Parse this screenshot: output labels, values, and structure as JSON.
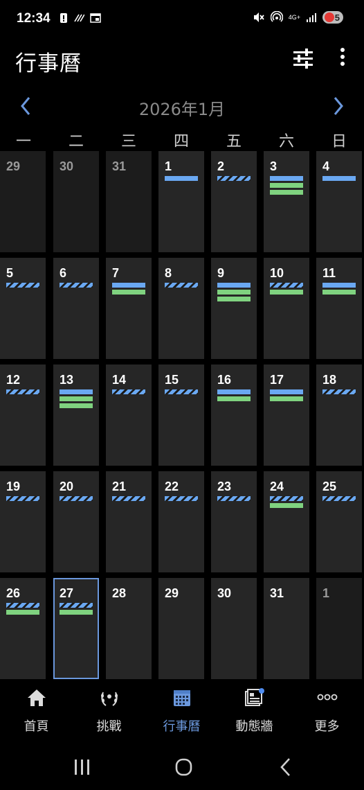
{
  "status_bar": {
    "time": "12:34",
    "network_label": "4G+",
    "battery_level": "5",
    "icons": [
      "alert-icon",
      "stripes-icon",
      "calendar-small-icon",
      "mute-icon",
      "hotspot-icon",
      "signal-icon",
      "battery-icon"
    ]
  },
  "app_bar": {
    "title": "行事曆",
    "icons": [
      "filter-sliders-icon",
      "more-vert-icon"
    ]
  },
  "month_header": {
    "label": "2026年1月",
    "prev_icon": "chevron-left-icon",
    "next_icon": "chevron-right-icon"
  },
  "weekdays": [
    "一",
    "二",
    "三",
    "四",
    "五",
    "六",
    "日"
  ],
  "weeks": [
    [
      {
        "day": "29",
        "dim": true,
        "bars": []
      },
      {
        "day": "30",
        "dim": true,
        "bars": []
      },
      {
        "day": "31",
        "dim": true,
        "bars": []
      },
      {
        "day": "1",
        "bars": [
          "solid"
        ]
      },
      {
        "day": "2",
        "bars": [
          "striped"
        ]
      },
      {
        "day": "3",
        "bars": [
          "solid",
          "green",
          "green"
        ]
      },
      {
        "day": "4",
        "bars": [
          "solid"
        ]
      }
    ],
    [
      {
        "day": "5",
        "bars": [
          "striped"
        ]
      },
      {
        "day": "6",
        "bars": [
          "striped"
        ]
      },
      {
        "day": "7",
        "bars": [
          "solid",
          "green"
        ]
      },
      {
        "day": "8",
        "bars": [
          "striped"
        ]
      },
      {
        "day": "9",
        "bars": [
          "solid",
          "green",
          "green"
        ]
      },
      {
        "day": "10",
        "bars": [
          "striped",
          "green"
        ]
      },
      {
        "day": "11",
        "bars": [
          "solid",
          "green"
        ]
      }
    ],
    [
      {
        "day": "12",
        "bars": [
          "striped"
        ]
      },
      {
        "day": "13",
        "bars": [
          "solid",
          "green",
          "green"
        ]
      },
      {
        "day": "14",
        "bars": [
          "striped"
        ]
      },
      {
        "day": "15",
        "bars": [
          "striped"
        ]
      },
      {
        "day": "16",
        "bars": [
          "solid",
          "green"
        ]
      },
      {
        "day": "17",
        "bars": [
          "solid",
          "green"
        ]
      },
      {
        "day": "18",
        "bars": [
          "striped"
        ]
      }
    ],
    [
      {
        "day": "19",
        "bars": [
          "striped"
        ]
      },
      {
        "day": "20",
        "bars": [
          "striped"
        ]
      },
      {
        "day": "21",
        "bars": [
          "striped"
        ]
      },
      {
        "day": "22",
        "bars": [
          "striped"
        ]
      },
      {
        "day": "23",
        "bars": [
          "striped"
        ]
      },
      {
        "day": "24",
        "bars": [
          "striped",
          "green"
        ]
      },
      {
        "day": "25",
        "bars": [
          "striped"
        ]
      }
    ],
    [
      {
        "day": "26",
        "bars": [
          "striped",
          "green"
        ]
      },
      {
        "day": "27",
        "selected": true,
        "bars": [
          "striped",
          "green"
        ]
      },
      {
        "day": "28",
        "bars": []
      },
      {
        "day": "29",
        "bars": []
      },
      {
        "day": "30",
        "bars": []
      },
      {
        "day": "31",
        "bars": []
      },
      {
        "day": "1",
        "dim": true,
        "bars": []
      }
    ]
  ],
  "bottom_nav": [
    {
      "label": "首頁",
      "icon": "home-icon"
    },
    {
      "label": "挑戰",
      "icon": "laurel-icon"
    },
    {
      "label": "行事曆",
      "icon": "calendar-icon",
      "active": true
    },
    {
      "label": "動態牆",
      "icon": "newsfeed-icon"
    },
    {
      "label": "更多",
      "icon": "more-horiz-icon"
    }
  ],
  "colors": {
    "accent": "#6b98dd",
    "event_blue": "#6aa8f2",
    "event_green": "#7fd27f",
    "cell_bg": "#262626"
  }
}
